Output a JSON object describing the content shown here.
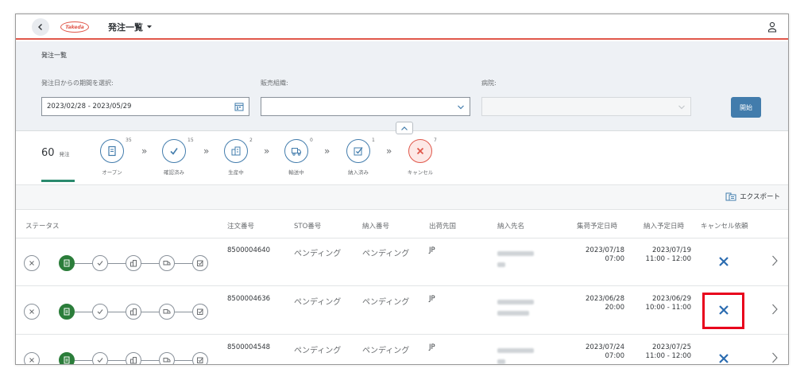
{
  "shell": {
    "title": "発注一覧",
    "logo_text": "Takeda"
  },
  "filter": {
    "section_title": "発注一覧",
    "date_label": "発注日からの期間を選択:",
    "date_value": "2023/02/28 - 2023/05/29",
    "sales_org_label": "販売組織:",
    "sales_org_value": "",
    "hospital_label": "病院:",
    "hospital_value": "",
    "go_label": "開始"
  },
  "status_summary": {
    "total_count": "60",
    "total_unit": "発注",
    "steps": [
      {
        "label": "オープン",
        "count": "35",
        "icon": "document-icon"
      },
      {
        "label": "確認済み",
        "count": "15",
        "icon": "check-icon"
      },
      {
        "label": "生産中",
        "count": "2",
        "icon": "factory-icon"
      },
      {
        "label": "輸送中",
        "count": "0",
        "icon": "truck-icon"
      },
      {
        "label": "納入済み",
        "count": "1",
        "icon": "delivered-icon"
      },
      {
        "label": "キャンセル",
        "count": "7",
        "icon": "cancel-icon"
      }
    ]
  },
  "toolbar": {
    "export_label": "エクスポート"
  },
  "table": {
    "headers": {
      "status": "ステータス",
      "order_no": "注文番号",
      "sto_no": "STO番号",
      "delivery_no": "納入番号",
      "ship_country": "出荷先国",
      "ship_to_name": "納入先名",
      "pickup_date": "集荷予定日時",
      "delivery_date": "納入予定日時",
      "cancel_request": "キャンセル依頼"
    },
    "rows": [
      {
        "order_no": "8500004640",
        "sto_no": "ペンディング",
        "delivery_no": "ペンディング",
        "ship_country": "JP",
        "pickup_date": "2023/07/18",
        "pickup_time": "07:00",
        "delivery_date": "2023/07/19",
        "delivery_time": "11:00 - 12:00"
      },
      {
        "order_no": "8500004636",
        "sto_no": "ペンディング",
        "delivery_no": "ペンディング",
        "ship_country": "JP",
        "pickup_date": "2023/06/28",
        "pickup_time": "20:00",
        "delivery_date": "2023/06/29",
        "delivery_time": "10:00 - 11:00"
      },
      {
        "order_no": "8500004548",
        "sto_no": "ペンディング",
        "delivery_no": "ペンディング",
        "ship_country": "JP",
        "pickup_date": "2023/07/24",
        "pickup_time": "07:00",
        "delivery_date": "2023/07/25",
        "delivery_time": "11:00 - 12:00"
      }
    ]
  },
  "colors": {
    "accent": "#427cac",
    "brand": "#e0574a",
    "active_status": "#2b7d3a",
    "highlight": "#e8001c"
  }
}
